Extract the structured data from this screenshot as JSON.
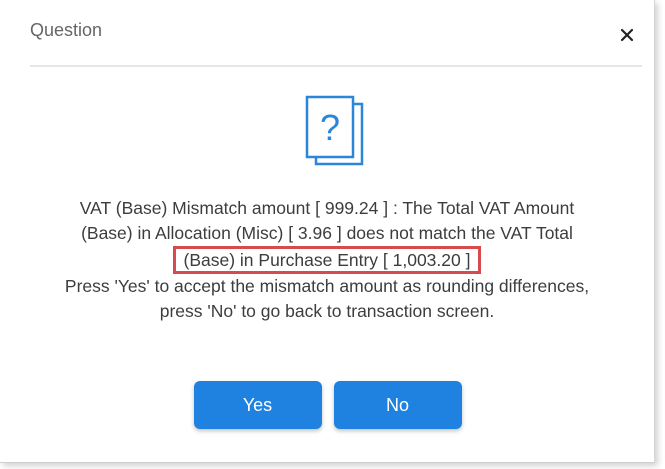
{
  "dialog": {
    "title": "Question",
    "close_icon": "close-icon",
    "question_icon": "question-document-icon",
    "message": {
      "line1": "VAT (Base) Mismatch amount [ 999.24 ] : The Total VAT Amount",
      "line2": "(Base) in Allocation (Misc) [ 3.96 ] does not match the VAT Total",
      "line3_highlighted": "(Base) in Purchase Entry [ 1,003.20 ]",
      "line4": "Press 'Yes' to accept the mismatch amount as rounding differences,",
      "line5": "press 'No' to go back to transaction screen."
    },
    "buttons": {
      "yes_label": "Yes",
      "no_label": "No"
    },
    "colors": {
      "accent": "#1f82e0",
      "highlight_border": "#d84b4b",
      "icon": "#2a86d9"
    }
  }
}
